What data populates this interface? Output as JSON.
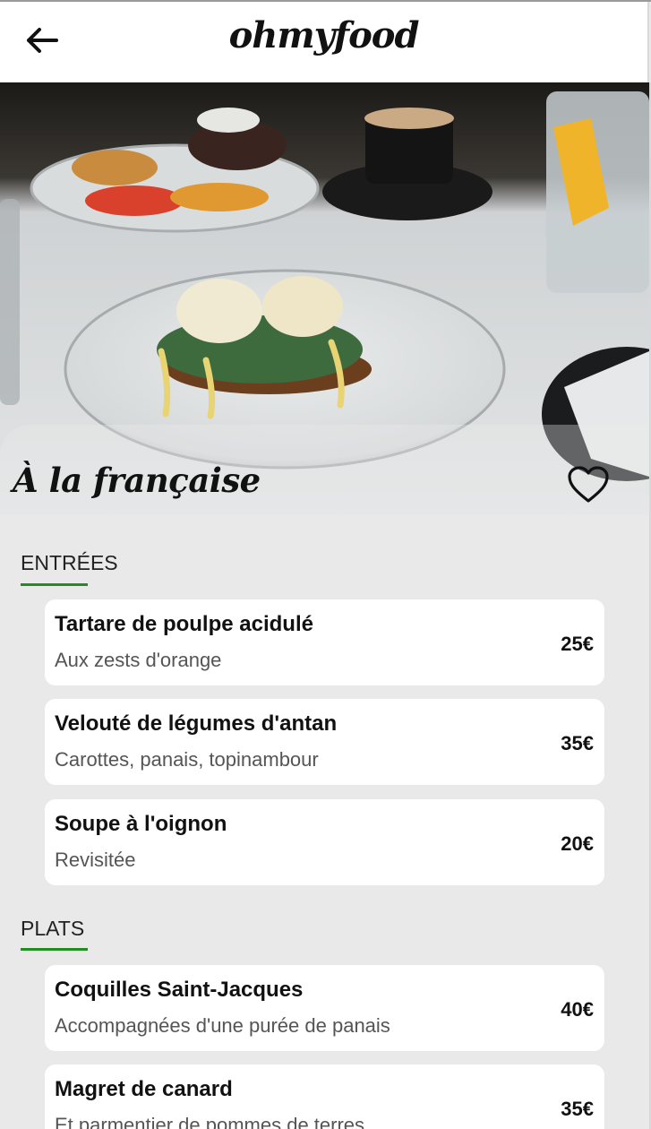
{
  "header": {
    "brand": "ohmyfood",
    "back_icon": "arrow-left-icon"
  },
  "hero": {
    "title": "À la française",
    "favorite_icon": "heart-outline-icon"
  },
  "colors": {
    "accent": "#1e8e1e",
    "background": "#e9e9e9",
    "card": "#ffffff"
  },
  "sections": [
    {
      "title": "ENTRÉES",
      "items": [
        {
          "name": "Tartare de poulpe acidulé",
          "description": "Aux zests d'orange",
          "price": "25€"
        },
        {
          "name": "Velouté de légumes d'antan",
          "description": "Carottes, panais, topinambour",
          "price": "35€"
        },
        {
          "name": "Soupe à l'oignon",
          "description": "Revisitée",
          "price": "20€"
        }
      ]
    },
    {
      "title": "PLATS",
      "items": [
        {
          "name": "Coquilles Saint-Jacques",
          "description": "Accompagnées d'une purée de panais",
          "price": "40€"
        },
        {
          "name": "Magret de canard",
          "description": "Et parmentier de pommes de terres",
          "price": "35€"
        }
      ]
    }
  ]
}
